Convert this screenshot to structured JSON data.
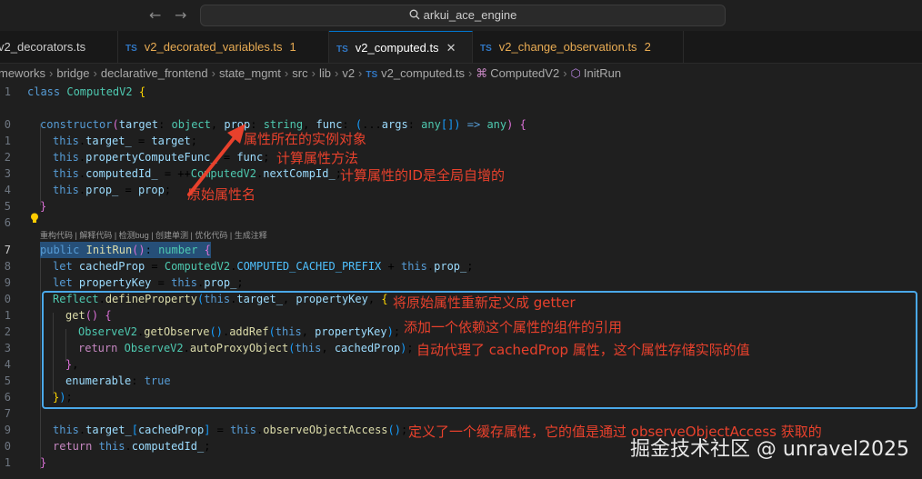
{
  "titlebar": {
    "back_icon": "←",
    "forward_icon": "→",
    "search_text": "arkui_ace_engine"
  },
  "tabs": [
    {
      "label": "v2_decorators.ts",
      "badge": "",
      "active": false
    },
    {
      "label": "v2_decorated_variables.ts",
      "badge": "1",
      "active": false
    },
    {
      "label": "v2_computed.ts",
      "badge": "",
      "active": true
    },
    {
      "label": "v2_change_observation.ts",
      "badge": "2",
      "active": false
    }
  ],
  "tab_ts_label": "TS",
  "tab_close": "✕",
  "breadcrumb": [
    "meworks",
    "bridge",
    "declarative_frontend",
    "state_mgmt",
    "src",
    "lib",
    "v2",
    "v2_computed.ts",
    "ComputedV2",
    "InitRun"
  ],
  "line_numbers": [
    "1",
    "",
    "0",
    "1",
    "2",
    "3",
    "4",
    "5",
    "6",
    "",
    "7",
    "8",
    "9",
    "0",
    "1",
    "2",
    "3",
    "4",
    "5",
    "6",
    "7",
    "",
    "9",
    "0",
    "1"
  ],
  "codelens": "重构代码 | 解释代码 | 检测bug | 创建单测 | 优化代码 | 生成注释",
  "annotations": {
    "a1": "属性所在的实例对象",
    "a2": "计算属性方法",
    "a3": "计算属性的ID是全局自增的",
    "a4": "原始属性名",
    "a5": "将原始属性重新定义成 getter",
    "a6": "添加一个依赖这个属性的组件的引用",
    "a7": "自动代理了 cachedProp 属性，这个属性存储实际的值",
    "a8": "定义了一个缓存属性，它的值是通过 observeObjectAccess 获取的"
  },
  "watermark": "掘金技术社区 @ unravel2025"
}
